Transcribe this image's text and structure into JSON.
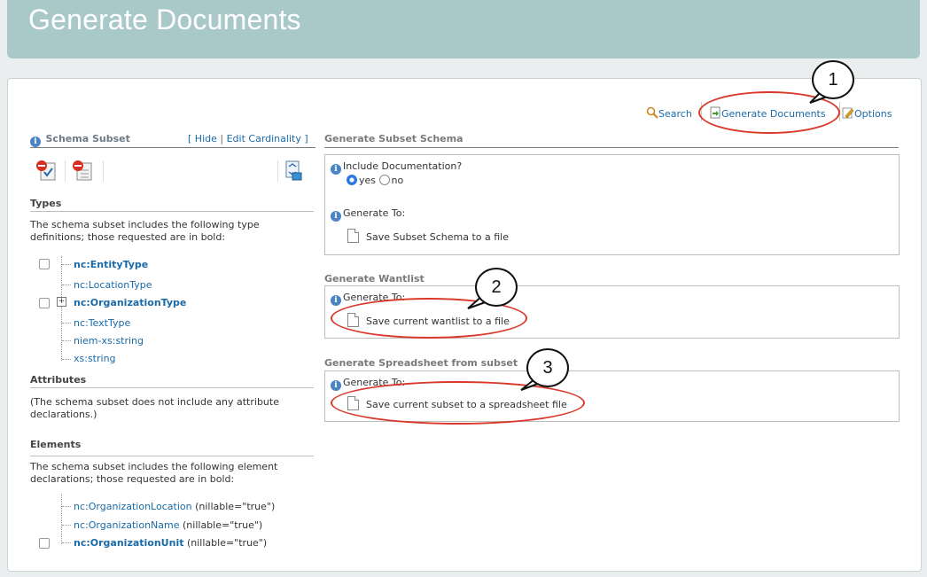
{
  "header": {
    "title": "Generate Documents"
  },
  "toolbar": {
    "search": "Search",
    "generate_documents": "Generate Documents",
    "options": "Options"
  },
  "left": {
    "schema_subset_title": "Schema Subset",
    "bracket_open": "[",
    "hide": "Hide",
    "separator": "|",
    "edit_cardinality": "Edit Cardinality",
    "bracket_close": "]",
    "types_heading": "Types",
    "types_desc": "The schema subset includes the following type definitions; those requested are in bold:",
    "types": [
      {
        "prefix": "nc:",
        "name": "EntityType",
        "bold": true
      },
      {
        "prefix": "nc:",
        "name": "LocationType",
        "bold": false
      },
      {
        "prefix": "nc:",
        "name": "OrganizationType",
        "bold": true
      },
      {
        "prefix": "nc:",
        "name": "TextType",
        "bold": false
      },
      {
        "prefix": "niem-xs:",
        "name": "string",
        "bold": false
      },
      {
        "prefix": "xs:",
        "name": "string",
        "bold": false
      }
    ],
    "expander": "+",
    "attributes_heading": "Attributes",
    "attributes_desc": "(The schema subset does not include any attribute declarations.)",
    "elements_heading": "Elements",
    "elements_desc": "The schema subset includes the following element declarations; those requested are in bold:",
    "elements": [
      {
        "prefix": "nc:",
        "name": "OrganizationLocation",
        "suffix": " (nillable=\"true\")",
        "bold": false
      },
      {
        "prefix": "nc:",
        "name": "OrganizationName",
        "suffix": " (nillable=\"true\")",
        "bold": false
      },
      {
        "prefix": "nc:",
        "name": "OrganizationUnit",
        "suffix": " (nillable=\"true\")",
        "bold": true
      }
    ]
  },
  "right": {
    "subset_schema_title": "Generate Subset Schema",
    "include_doc_label": "Include Documentation?",
    "yes": "yes",
    "no": "no",
    "generate_to": "Generate To:",
    "save_schema": "Save Subset Schema to a file",
    "wantlist_title": "Generate Wantlist",
    "save_wantlist": "Save current wantlist to a file",
    "spreadsheet_title": "Generate Spreadsheet from subset",
    "save_spreadsheet": "Save current subset to a spreadsheet file"
  },
  "callouts": [
    "1",
    "2",
    "3"
  ],
  "colors": {
    "header": "#a9c9c9",
    "link": "#1a6aa8",
    "callout": "#d9382a",
    "info": "#4a84c3"
  }
}
